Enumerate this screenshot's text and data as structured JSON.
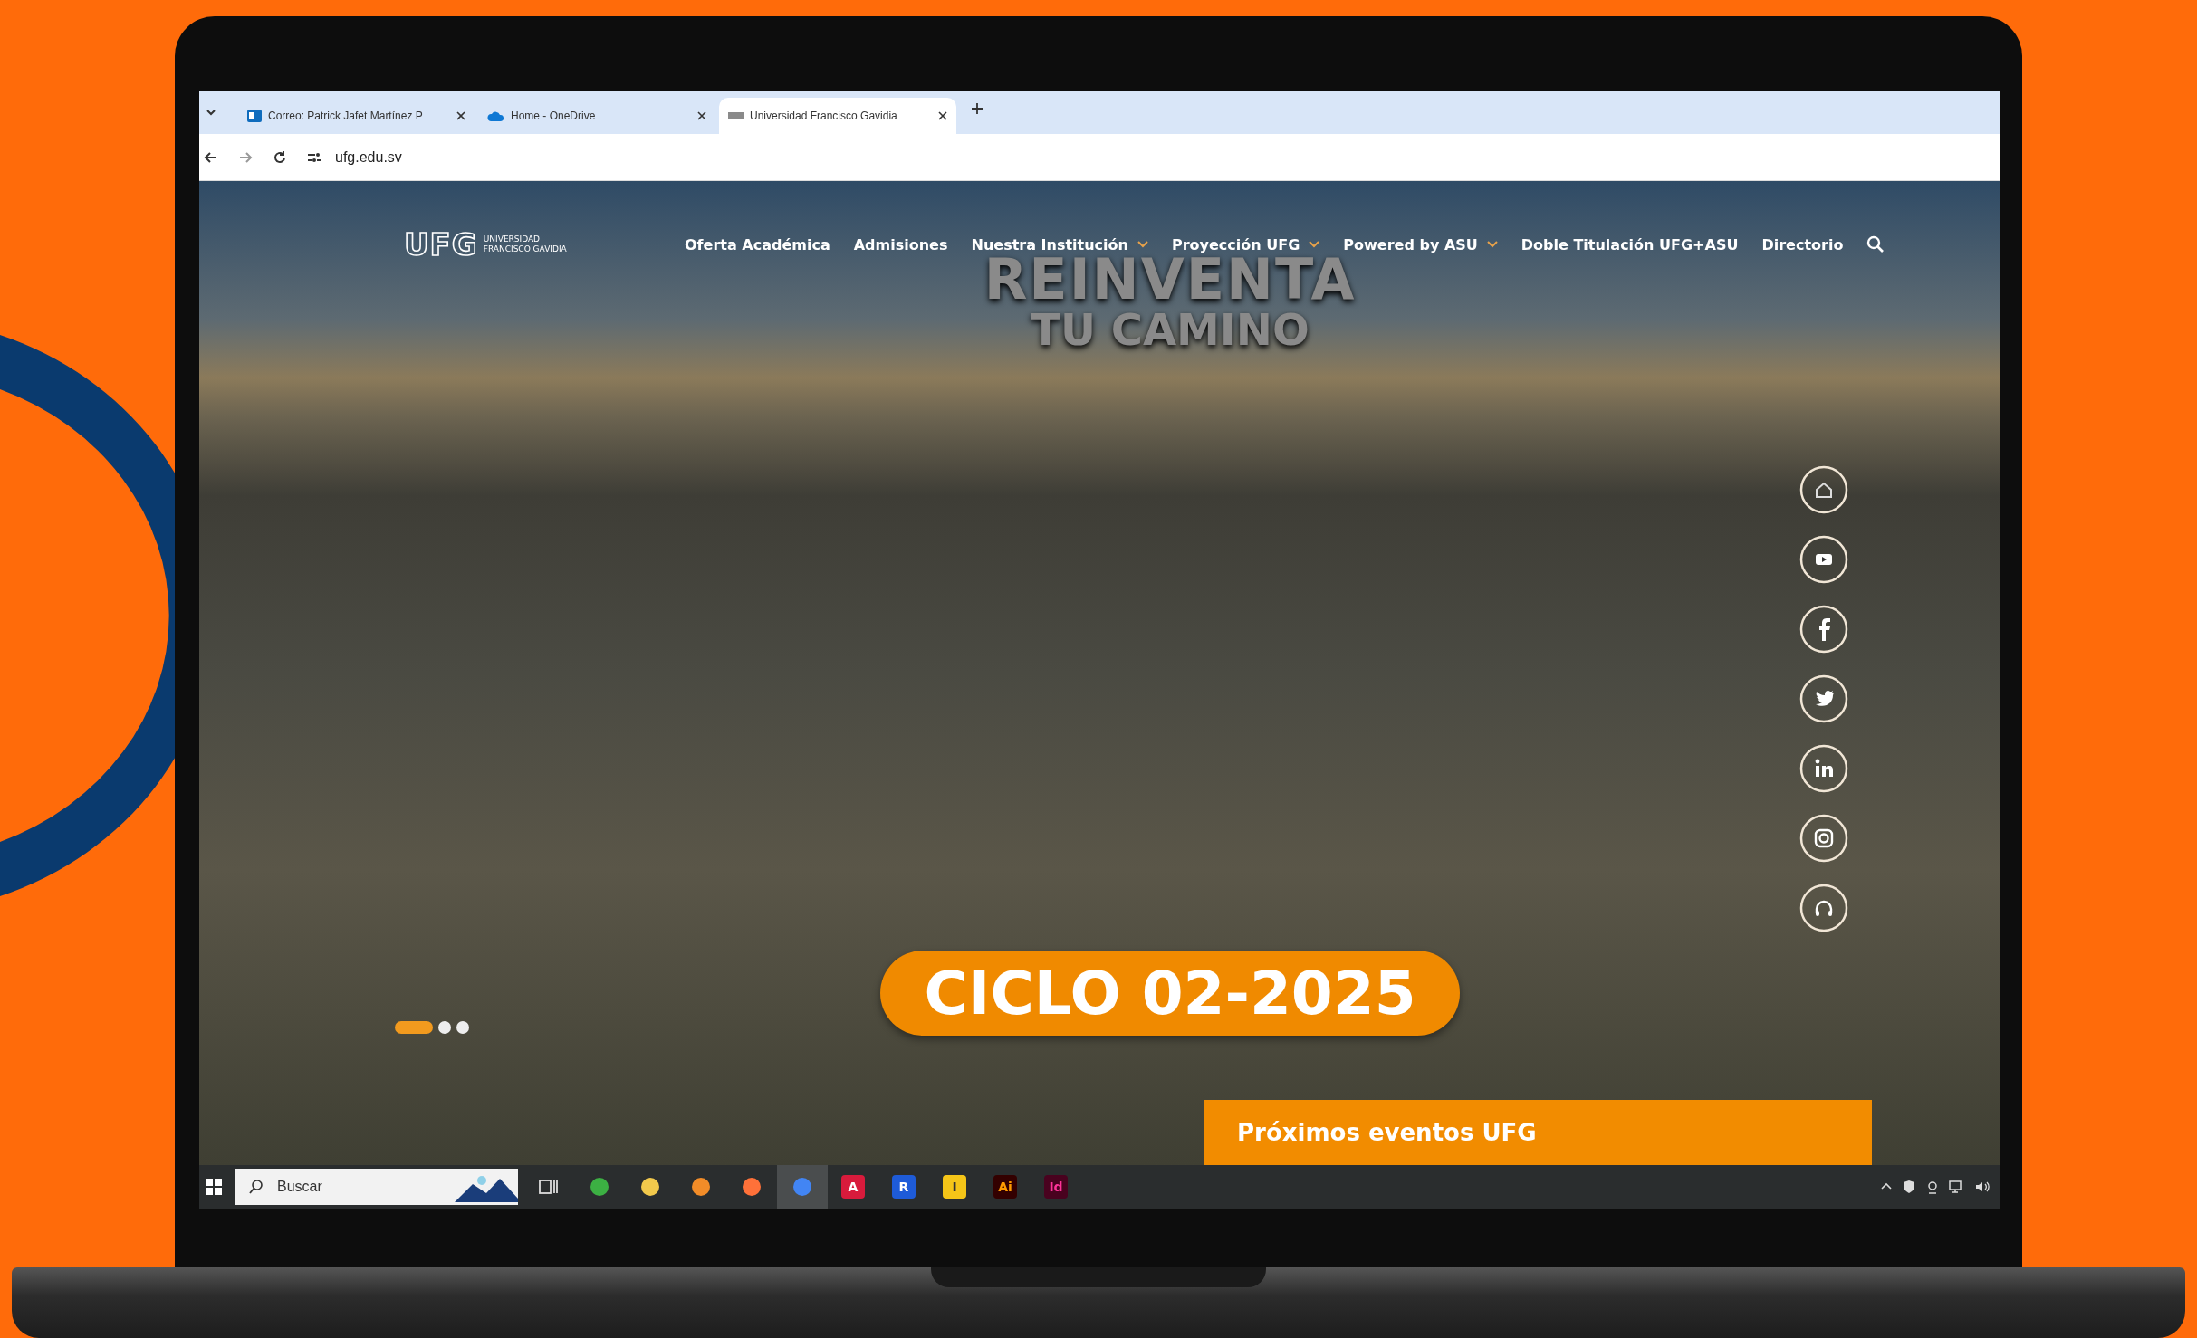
{
  "browser": {
    "tabs": [
      {
        "title": "Correo: Patrick Jafet Martínez P",
        "selected": false
      },
      {
        "title": "Home - OneDrive",
        "selected": false
      },
      {
        "title": "Universidad Francisco Gavidia",
        "selected": true
      }
    ],
    "address": "ufg.edu.sv"
  },
  "site": {
    "logo": {
      "mark": "UFG",
      "name_1": "UNIVERSIDAD",
      "name_2": "FRANCISCO GAVIDIA"
    },
    "nav": [
      {
        "label": "Oferta Académica",
        "dropdown": false
      },
      {
        "label": "Admisiones",
        "dropdown": false
      },
      {
        "label": "Nuestra Institución",
        "dropdown": true
      },
      {
        "label": "Proyección UFG",
        "dropdown": true
      },
      {
        "label": "Powered by ASU",
        "dropdown": true
      },
      {
        "label": "Doble Titulación UFG+ASU",
        "dropdown": false
      },
      {
        "label": "Directorio",
        "dropdown": false
      }
    ],
    "hero": {
      "title_1": "REINVENTA",
      "title_2": "TU CAMINO",
      "badge": "CICLO 02-2025"
    },
    "slides": [
      {
        "selected": true
      },
      {
        "selected": false
      },
      {
        "selected": false
      }
    ],
    "events_button": "Próximos eventos UFG"
  },
  "taskbar": {
    "search_placeholder": "Buscar",
    "apps": [
      {
        "selected": false
      },
      {
        "selected": false
      },
      {
        "selected": false
      },
      {
        "selected": false
      },
      {
        "selected": false
      },
      {
        "selected": true
      },
      {
        "label": "A",
        "selected": false
      },
      {
        "label": "R",
        "selected": false
      },
      {
        "label": "I",
        "selected": false
      },
      {
        "label": "Ai",
        "selected": false
      },
      {
        "label": "Id",
        "selected": false
      }
    ]
  }
}
